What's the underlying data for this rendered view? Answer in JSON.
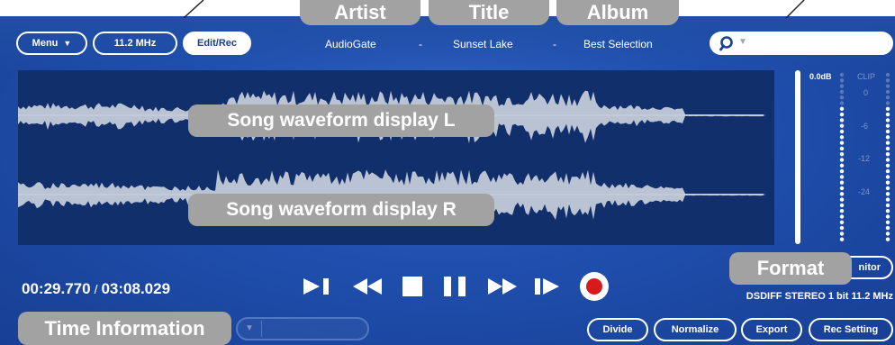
{
  "toolbar": {
    "menu_label": "Menu",
    "sample_rate": "11.2 MHz",
    "edit_rec_label": "Edit/Rec",
    "monitor_label": "nitor"
  },
  "song": {
    "artist": "AudioGate",
    "title": "Sunset Lake",
    "album": "Best Selection",
    "separator": "-"
  },
  "search": {
    "placeholder": ""
  },
  "meter": {
    "peak_label": "0.0dB",
    "clip_label": "CLIP",
    "scale": [
      "0",
      "-6",
      "-12",
      "-24"
    ]
  },
  "time": {
    "current": "00:29.770",
    "separator": "/",
    "total": "03:08.029"
  },
  "format_info": "DSDIFF STEREO 1 bit 11.2 MHz",
  "bottom_buttons": {
    "divide": "Divide",
    "normalize": "Normalize",
    "export": "Export",
    "rec_setting": "Rec Setting"
  },
  "annotations": {
    "artist": "Artist",
    "title": "Title",
    "album": "Album",
    "waveform_l": "Song waveform display L",
    "waveform_r": "Song waveform display R",
    "format": "Format",
    "time_information": "Time Information"
  },
  "icons": {
    "transport": [
      "play-to-end-icon",
      "rewind-icon",
      "stop-icon",
      "pause-icon",
      "fast-forward-icon",
      "step-play-icon",
      "record-icon"
    ]
  },
  "colors": {
    "background": "#1f4fae",
    "waveform_bg": "#112f6b",
    "waveform": "#d8dde6",
    "record": "#d71a1a",
    "annotation": "#a2a2a2"
  }
}
